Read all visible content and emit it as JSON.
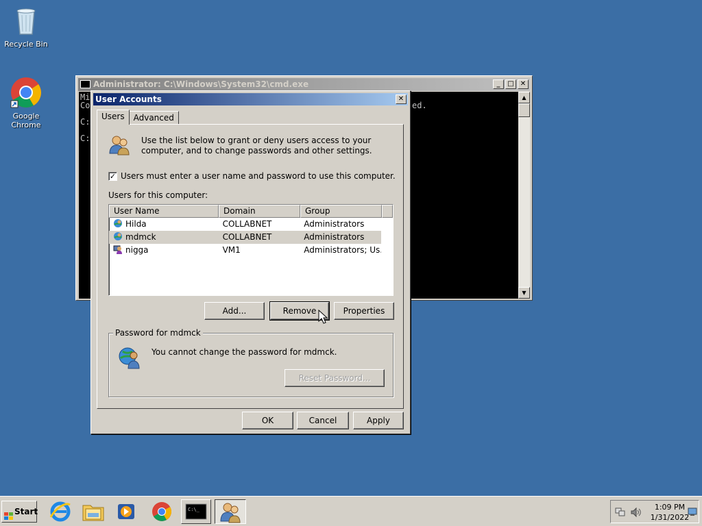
{
  "desktop": {
    "icons": [
      {
        "label": "Recycle Bin",
        "icon": "recycle-bin-icon"
      },
      {
        "label": "Google Chrome",
        "icon": "chrome-icon"
      }
    ]
  },
  "cmd_window": {
    "title": "Administrator: C:\\Windows\\System32\\cmd.exe",
    "visible_lines": [
      "Mi",
      "Co",
      "",
      "C:",
      "",
      "C:"
    ],
    "fragment_right": "ed."
  },
  "dialog": {
    "title": "User Accounts",
    "tabs": [
      {
        "label": "Users",
        "active": true
      },
      {
        "label": "Advanced",
        "active": false
      }
    ],
    "intro_text": "Use the list below to grant or deny users access to your computer, and to change passwords and other settings.",
    "checkbox": {
      "label": "Users must enter a user name and password to use this computer.",
      "checked": true
    },
    "list_label": "Users for this computer:",
    "columns": [
      "User Name",
      "Domain",
      "Group"
    ],
    "users": [
      {
        "name": "Hilda",
        "domain": "COLLABNET",
        "group": "Administrators",
        "selected": false,
        "icon": "domain-user-icon"
      },
      {
        "name": "mdmck",
        "domain": "COLLABNET",
        "group": "Administrators",
        "selected": true,
        "icon": "domain-user-icon"
      },
      {
        "name": "nigga",
        "domain": "VM1",
        "group": "Administrators; Us...",
        "selected": false,
        "icon": "local-user-icon"
      }
    ],
    "buttons": {
      "add": "Add...",
      "remove": "Remove",
      "properties": "Properties"
    },
    "password_group": {
      "legend": "Password for mdmck",
      "message": "You cannot change the password for mdmck.",
      "reset_button": "Reset Password..."
    },
    "footer": {
      "ok": "OK",
      "cancel": "Cancel",
      "apply": "Apply"
    }
  },
  "taskbar": {
    "start_label": "Start",
    "items": [
      "internet-explorer-icon",
      "file-explorer-icon",
      "media-player-icon",
      "chrome-icon",
      "cmd-icon",
      "user-accounts-icon"
    ],
    "clock": {
      "time": "1:09 PM",
      "date": "1/31/2022"
    }
  },
  "colors": {
    "desktop": "#3b6ea5",
    "active_title": "#0a246a",
    "inactive_title": "#808080",
    "face": "#d4d0c8"
  }
}
